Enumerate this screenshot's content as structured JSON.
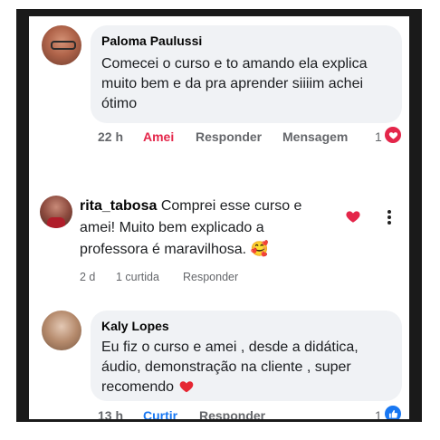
{
  "comments": [
    {
      "author": "Paloma Paulussi",
      "text": "Comecei o curso e to amando ela explica muito bem e da pra aprender siiiim achei ótimo",
      "time": "22 h",
      "action_react": "Amei",
      "action_reply": "Responder",
      "action_message": "Mensagem",
      "reaction_count": "1"
    },
    {
      "author": "rita_tabosa",
      "text_line1": "Comprei esse curso e",
      "text_line2": "amei! Muito bem explicado a",
      "text_line3": "professora é maravilhosa.",
      "emoji": "🥰",
      "time": "2 d",
      "likes": "1 curtida",
      "action_reply": "Responder"
    },
    {
      "author": "Kaly Lopes",
      "text": "Eu fiz o curso e amei , desde a didática, áudio, demonstração na cliente , super recomendo",
      "time": "13 h",
      "action_react": "Curtir",
      "action_reply": "Responder",
      "reaction_count": "1"
    }
  ],
  "colors": {
    "love": "#e4264a",
    "like": "#1877f2",
    "bubble": "#f0f2f5"
  }
}
